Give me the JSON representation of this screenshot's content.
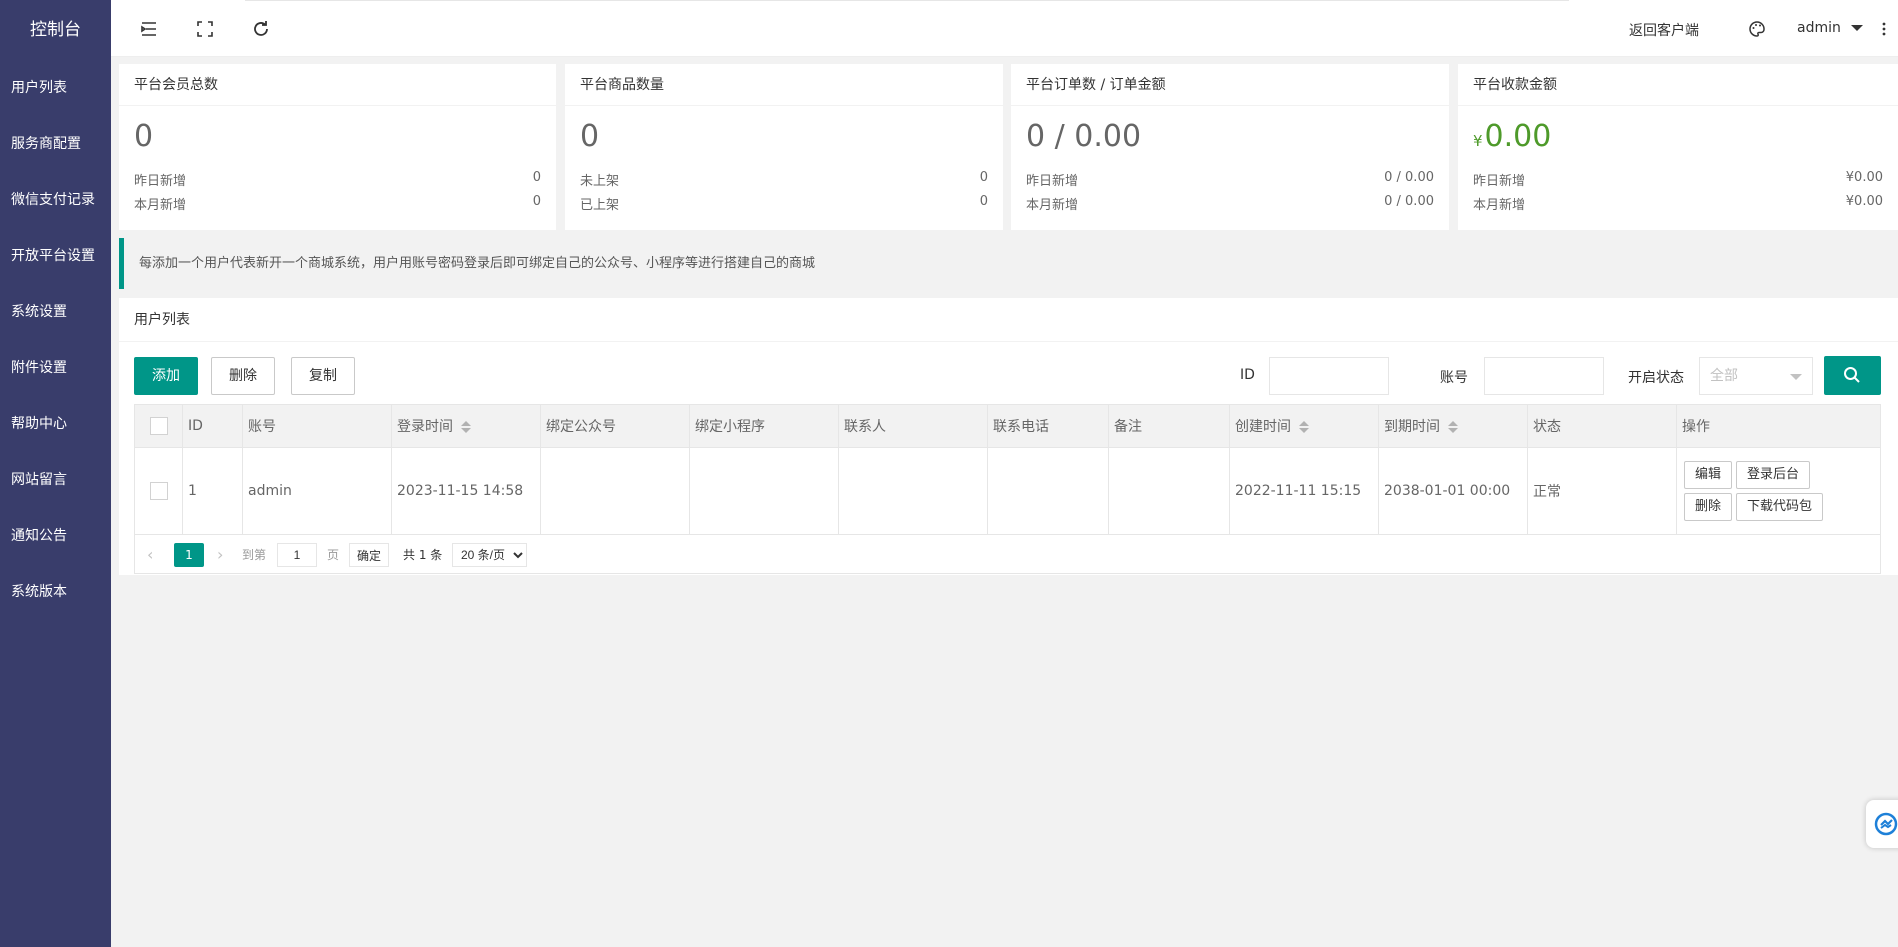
{
  "sidebar": {
    "title": "控制台",
    "items": [
      {
        "label": "用户列表"
      },
      {
        "label": "服务商配置"
      },
      {
        "label": "微信支付记录"
      },
      {
        "label": "开放平台设置"
      },
      {
        "label": "系统设置"
      },
      {
        "label": "附件设置"
      },
      {
        "label": "帮助中心"
      },
      {
        "label": "网站留言"
      },
      {
        "label": "通知公告"
      },
      {
        "label": "系统版本"
      }
    ]
  },
  "header": {
    "icons": [
      "menu-fold-icon",
      "fullscreen-icon",
      "refresh-icon"
    ],
    "return_client": "返回客户端",
    "theme_icon": "palette-icon",
    "user": "admin",
    "more_icon": "more-vertical-icon"
  },
  "cards": [
    {
      "title": "平台会员总数",
      "value": "0",
      "rows": [
        {
          "label": "昨日新增",
          "value": "0"
        },
        {
          "label": "本月新增",
          "value": "0"
        }
      ]
    },
    {
      "title": "平台商品数量",
      "value": "0",
      "rows": [
        {
          "label": "未上架",
          "value": "0"
        },
        {
          "label": "已上架",
          "value": "0"
        }
      ]
    },
    {
      "title": "平台订单数 / 订单金额",
      "value": "0 / 0.00",
      "rows": [
        {
          "label": "昨日新增",
          "value": "0 / 0.00"
        },
        {
          "label": "本月新增",
          "value": "0 / 0.00"
        }
      ]
    },
    {
      "title": "平台收款金额",
      "currency": "¥",
      "value": "0.00",
      "rows": [
        {
          "label": "昨日新增",
          "value": "¥0.00"
        },
        {
          "label": "本月新增",
          "value": "¥0.00"
        }
      ]
    }
  ],
  "notice": "每添加一个用户代表新开一个商城系统，用户用账号密码登录后即可绑定自己的公众号、小程序等进行搭建自己的商城",
  "panel": {
    "title": "用户列表",
    "buttons": {
      "add": "添加",
      "delete": "删除",
      "copy": "复制"
    },
    "filters": {
      "id_label": "ID",
      "id_value": "",
      "account_label": "账号",
      "account_value": "",
      "status_label": "开启状态",
      "status_selected": "全部"
    },
    "columns": [
      "ID",
      "账号",
      "登录时间",
      "绑定公众号",
      "绑定小程序",
      "联系人",
      "联系电话",
      "备注",
      "创建时间",
      "到期时间",
      "状态",
      "操作"
    ],
    "rows": [
      {
        "id": "1",
        "account": "admin",
        "login_time": "2023-11-15 14:58",
        "official_account": "",
        "mini_program": "",
        "contact": "",
        "phone": "",
        "remark": "",
        "created": "2022-11-11 15:15",
        "expires": "2038-01-01 00:00",
        "status": "正常",
        "actions": {
          "edit": "编辑",
          "login": "登录后台",
          "delete": "删除",
          "download": "下载代码包"
        }
      }
    ]
  },
  "pager": {
    "current": "1",
    "goto_label": "到第",
    "goto_value": "1",
    "page_suffix": "页",
    "confirm": "确定",
    "total": "共 1 条",
    "page_size": "20 条/页"
  },
  "colors": {
    "primary": "#009688",
    "sidebar": "#393d6b",
    "success": "#4e9a2a"
  }
}
